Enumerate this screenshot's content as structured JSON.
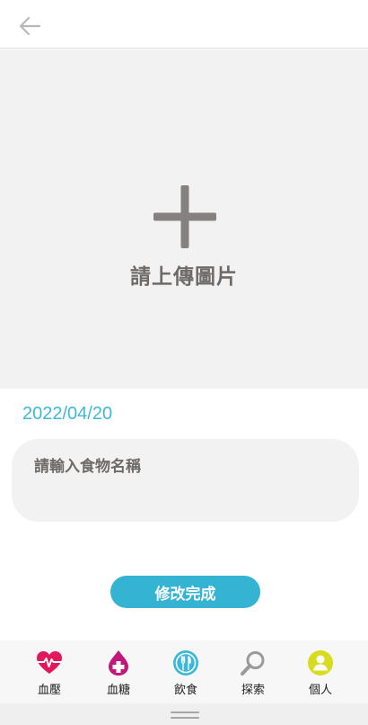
{
  "header": {
    "back_icon": "arrow-left-icon"
  },
  "upload": {
    "label": "請上傳圖片",
    "icon": "plus-icon",
    "icon_color": "#868080"
  },
  "entry": {
    "date": "2022/04/20",
    "food_placeholder": "請輸入食物名稱"
  },
  "actions": {
    "done_label": "修改完成",
    "done_color": "#35b3d3"
  },
  "nav": {
    "items": [
      {
        "label": "血壓",
        "icon": "heart-pulse-icon",
        "color": "#e2185b"
      },
      {
        "label": "血糖",
        "icon": "blood-drop-plus-icon",
        "color": "#c2187a"
      },
      {
        "label": "飲食",
        "icon": "fork-knife-icon",
        "color": "#3eb8d8"
      },
      {
        "label": "探索",
        "icon": "search-icon",
        "color": "#9a9a9a"
      },
      {
        "label": "個人",
        "icon": "user-icon",
        "color": "#d7dc1e"
      }
    ]
  }
}
